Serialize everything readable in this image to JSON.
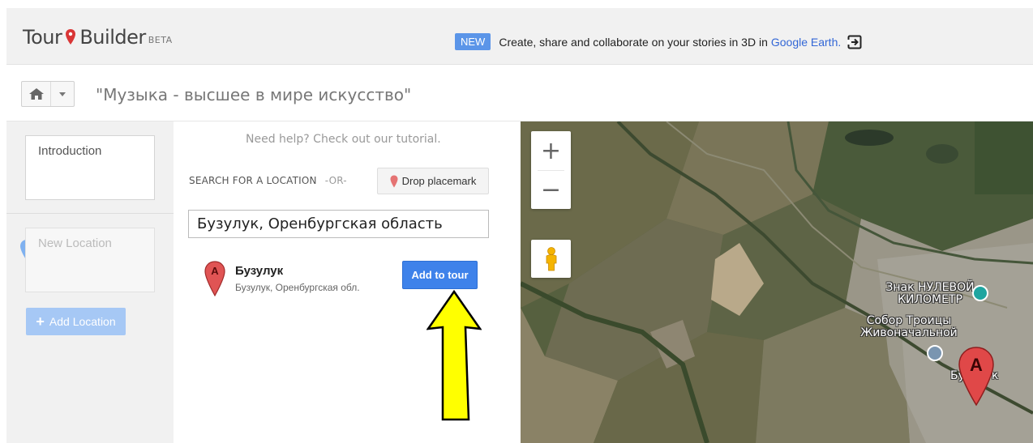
{
  "header": {
    "logo_left": "Tour",
    "logo_right": "Builder",
    "logo_beta": "BETA",
    "badge": "NEW",
    "promo_text": "Create, share and collaborate on your stories in 3D in",
    "promo_link": "Google Earth.",
    "exit_icon": "exit-to-app-icon"
  },
  "storybar": {
    "home_icon": "home-icon",
    "title": "\"Музыка - высшее в мире искусство\""
  },
  "sidebar": {
    "intro_label": "Introduction",
    "new_location_label": "New Location",
    "add_location_label": "Add Location"
  },
  "search": {
    "help_text": "Need help? Check out our tutorial.",
    "label": "SEARCH FOR A LOCATION",
    "or_text": "-OR-",
    "drop_label": "Drop placemark",
    "input_value": "Бузулук, Оренбургская область",
    "result": {
      "marker_letter": "A",
      "name": "Бузулук",
      "address": "Бузулук, Оренбургская обл."
    },
    "add_tour_label": "Add to tour"
  },
  "map": {
    "zoom_in": "+",
    "zoom_out": "−",
    "labels": {
      "znak": "Знак НУЛЕВОЙ КИЛОМЕТР",
      "sobor": "Собор Троицы Живоначальной",
      "buzuluk": "Бузулук"
    },
    "marker_letter": "A"
  },
  "colors": {
    "accent_blue": "#3e82ea",
    "marker_red": "#d93636",
    "arrow_yellow": "#ffff00"
  }
}
